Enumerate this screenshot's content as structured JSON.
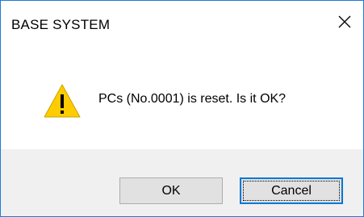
{
  "window": {
    "title": "BASE SYSTEM",
    "close_icon": "close-icon"
  },
  "message": {
    "icon": "warning-icon",
    "text": "PCs (No.0001) is reset. Is it OK?"
  },
  "buttons": {
    "ok_label": "OK",
    "cancel_label": "Cancel"
  },
  "colors": {
    "border_accent": "#1f7ad6",
    "warning_fill": "#ffcc00",
    "footer_bg": "#f0f0f0"
  }
}
